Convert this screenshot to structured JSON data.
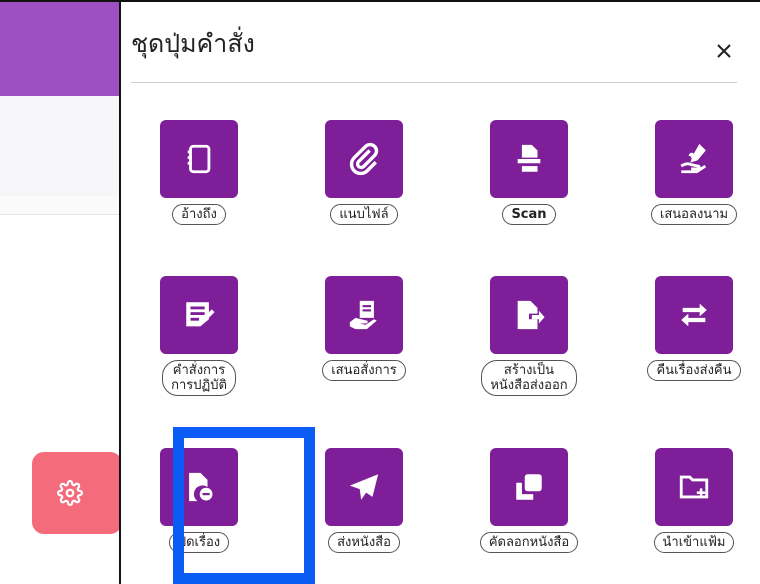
{
  "panel": {
    "title": "ชุดปุ่มคำสั่ง",
    "close_label": "×"
  },
  "commands": [
    {
      "label": "อ้างถึง",
      "icon": "notebook-icon"
    },
    {
      "label": "แนบไฟล์",
      "icon": "paperclip-icon"
    },
    {
      "label": "Scan",
      "icon": "scanner-icon"
    },
    {
      "label": "เสนอลงนาม",
      "icon": "sign-hand-icon"
    },
    {
      "label": "คำสั่งการ\nการปฏิบัติ",
      "icon": "message-edit-icon"
    },
    {
      "label": "เสนอสั่งการ",
      "icon": "hand-document-icon"
    },
    {
      "label": "สร้างเป็น\nหนังสือส่งออก",
      "icon": "file-export-icon"
    },
    {
      "label": "คืนเรื่องส่งคืน",
      "icon": "exchange-arrows-icon"
    },
    {
      "label": "ปิดเรื่อง",
      "icon": "file-minus-icon"
    },
    {
      "label": "ส่งหนังสือ",
      "icon": "paper-plane-icon"
    },
    {
      "label": "คัดลอกหนังสือ",
      "icon": "copy-icon"
    },
    {
      "label": "นำเข้าแฟ้ม",
      "icon": "folder-plus-icon"
    }
  ],
  "colors": {
    "tile": "#7e1e98",
    "header": "#9e4fc2",
    "settings": "#f46b7b",
    "highlight": "#0a5cf5"
  }
}
